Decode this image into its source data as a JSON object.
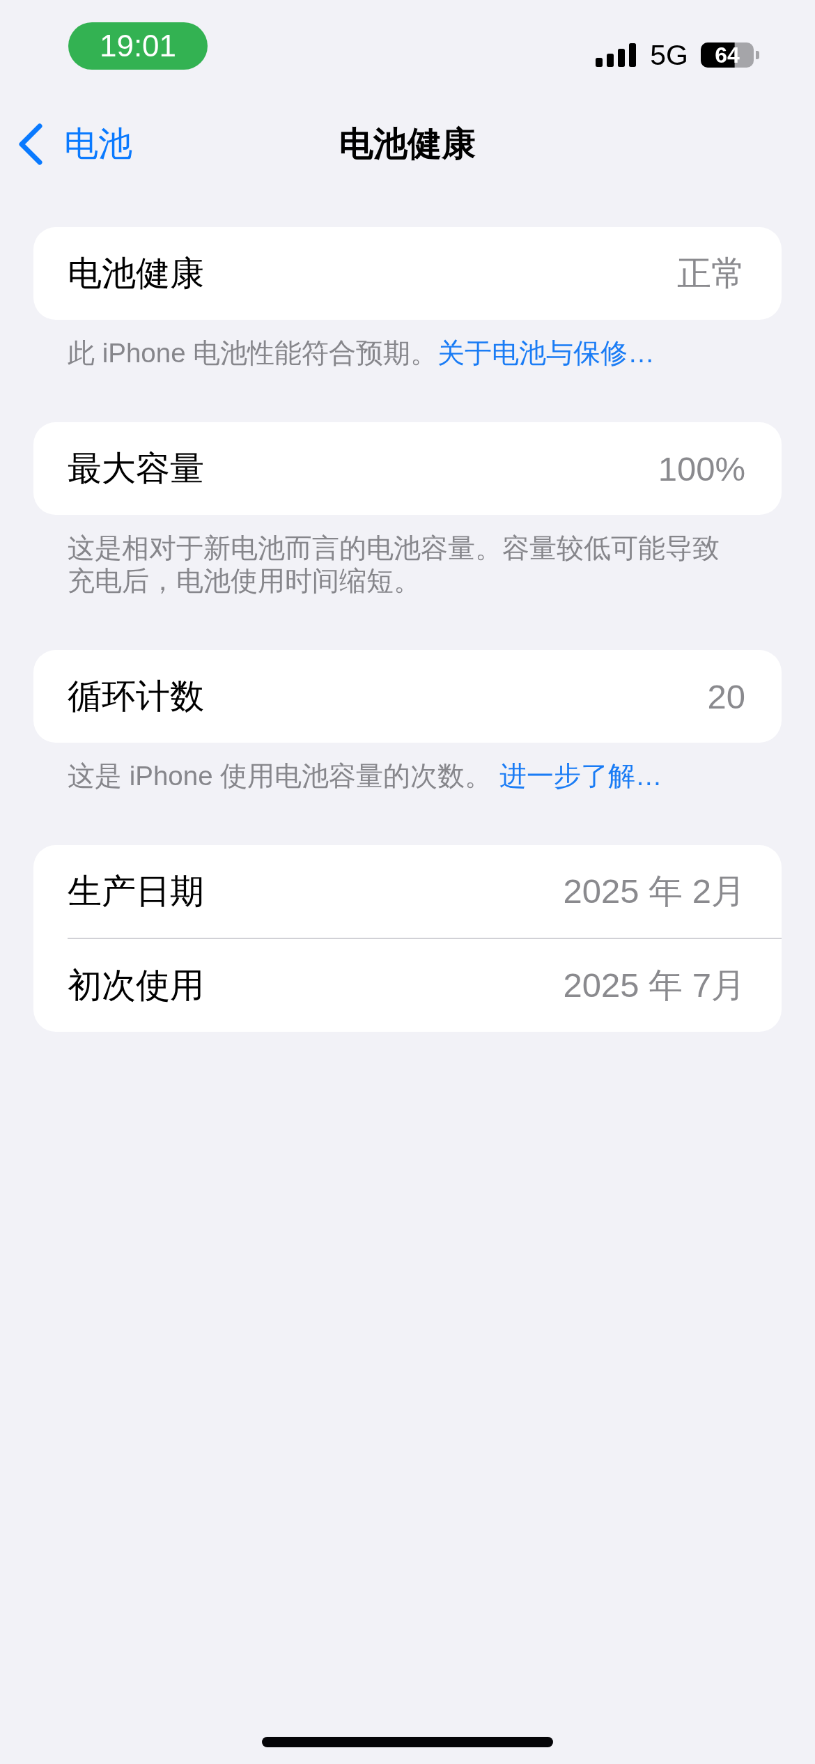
{
  "status_bar": {
    "time": "19:01",
    "network": "5G",
    "battery": "64"
  },
  "nav": {
    "back": "电池",
    "title": "电池健康"
  },
  "groups": [
    {
      "rows": [
        {
          "label": "电池健康",
          "value": "正常"
        }
      ],
      "footer": {
        "text": "此 iPhone 电池性能符合预期。",
        "link": "关于电池与保修…"
      }
    },
    {
      "rows": [
        {
          "label": "最大容量",
          "value": "100%"
        }
      ],
      "footer": {
        "text": "这是相对于新电池而言的电池容量。容量较低可能导致充电后，电池使用时间缩短。"
      }
    },
    {
      "rows": [
        {
          "label": "循环计数",
          "value": "20"
        }
      ],
      "footer": {
        "text": "这是 iPhone 使用电池容量的次数。 ",
        "link": "进一步了解…"
      }
    },
    {
      "rows": [
        {
          "label": "生产日期",
          "value": "2025 年 2月"
        },
        {
          "label": "初次使用",
          "value": "2025 年 7月"
        }
      ]
    }
  ]
}
